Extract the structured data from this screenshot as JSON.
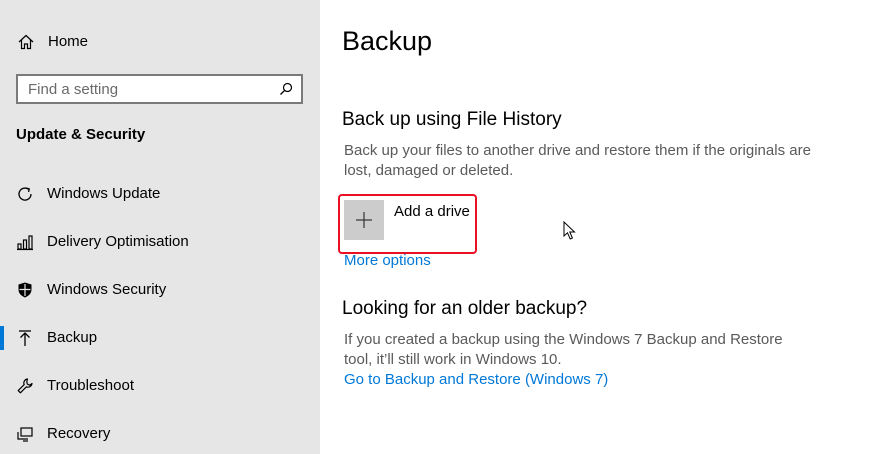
{
  "sidebar": {
    "home_label": "Home",
    "search": {
      "placeholder": "Find a setting"
    },
    "section_title": "Update & Security",
    "items": [
      {
        "label": "Windows Update",
        "icon": "sync-icon"
      },
      {
        "label": "Delivery Optimisation",
        "icon": "delivery-optimisation-icon"
      },
      {
        "label": "Windows Security",
        "icon": "shield-icon"
      },
      {
        "label": "Backup",
        "icon": "upload-arrow-icon",
        "selected": true
      },
      {
        "label": "Troubleshoot",
        "icon": "wrench-icon"
      },
      {
        "label": "Recovery",
        "icon": "recovery-icon"
      }
    ]
  },
  "main": {
    "title": "Backup",
    "file_history": {
      "heading": "Back up using File History",
      "description": "Back up your files to another drive and restore them if the originals are lost, damaged or deleted.",
      "add_drive_label": "Add a drive",
      "more_options": "More options"
    },
    "older_backup": {
      "heading": "Looking for an older backup?",
      "description": "If you created a backup using the Windows 7 Backup and Restore tool, it’ll still work in Windows 10.",
      "link": "Go to Backup and Restore (Windows 7)"
    }
  },
  "colors": {
    "accent": "#0078d7",
    "highlight": "#e81123",
    "sidebar_bg": "#e6e6e6"
  }
}
